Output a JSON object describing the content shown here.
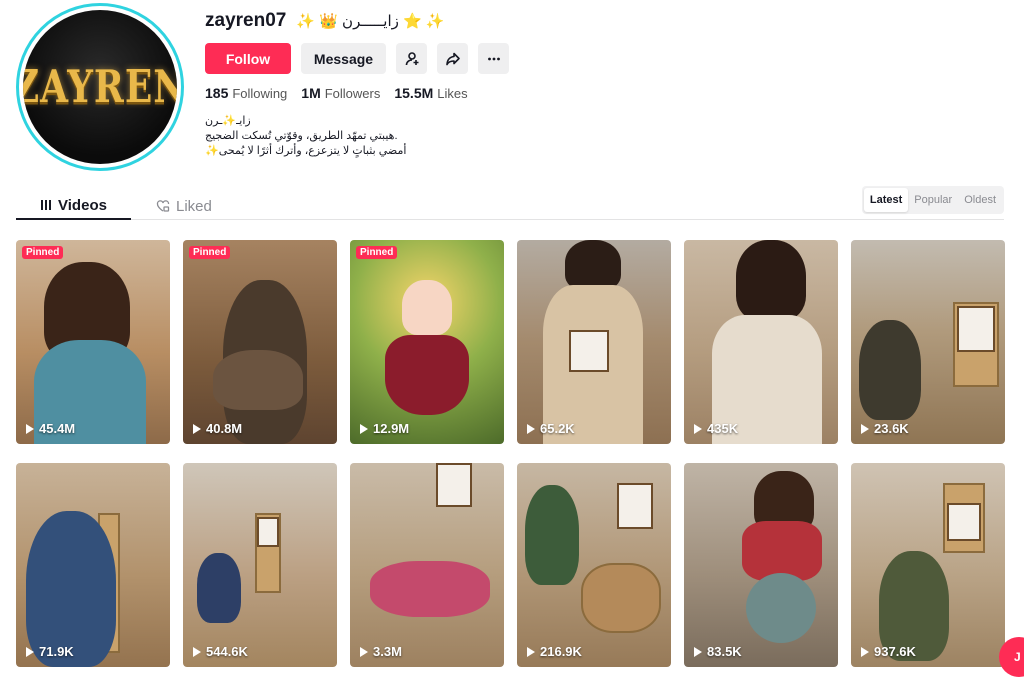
{
  "profile": {
    "avatar_text": "ZAYREN",
    "username": "zayren07",
    "nickname": "✨ 👑 زايـــــرن ⭐ ✨",
    "follow_label": "Follow",
    "message_label": "Message",
    "stats": {
      "following_count": "185",
      "following_label": "Following",
      "followers_count": "1M",
      "followers_label": "Followers",
      "likes_count": "15.5M",
      "likes_label": "Likes"
    },
    "bio": [
      "زايـ✨ـرن",
      ".هيبتي تمهّد الطريق، وقوّتي تُسكت الضجيج",
      "أمضي بثباتٍ لا يتزعزع، وأترك أثرًا لا يُمحى✨"
    ]
  },
  "tabs": {
    "videos": "Videos",
    "liked": "Liked"
  },
  "sort": {
    "latest": "Latest",
    "popular": "Popular",
    "oldest": "Oldest"
  },
  "pinned_label": "Pinned",
  "videos": [
    {
      "views": "45.4M",
      "pinned": true
    },
    {
      "views": "40.8M",
      "pinned": true
    },
    {
      "views": "12.9M",
      "pinned": true
    },
    {
      "views": "65.2K",
      "pinned": false
    },
    {
      "views": "435K",
      "pinned": false
    },
    {
      "views": "23.6K",
      "pinned": false
    },
    {
      "views": "71.9K",
      "pinned": false
    },
    {
      "views": "544.6K",
      "pinned": false
    },
    {
      "views": "3.3M",
      "pinned": false
    },
    {
      "views": "216.9K",
      "pinned": false
    },
    {
      "views": "83.5K",
      "pinned": false
    },
    {
      "views": "937.6K",
      "pinned": false
    }
  ],
  "fab_label": "J",
  "colors": {
    "accent": "#fe2c55",
    "avatar_ring": "#2fd3e0"
  }
}
